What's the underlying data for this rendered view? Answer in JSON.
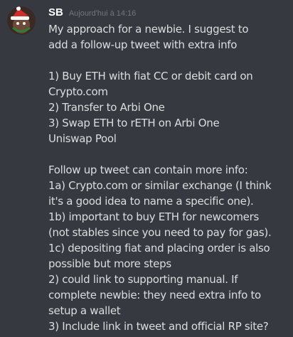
{
  "message": {
    "author": "SB",
    "timestamp": "Aujourd'hui à 14:16",
    "lines": [
      "My approach for a newbie. I suggest to",
      "add a follow-up tweet with extra info",
      "",
      "1) Buy ETH with fiat CC or debit card on",
      "Crypto.com",
      "2) Transfer to Arbi One",
      "3) Swap ETH to rETH on Arbi One",
      "Uniswap Pool",
      "",
      "Follow up tweet can contain more info:",
      "1a) Crypto.com or similar exchange (I think",
      "it's a good idea to name a specific one).",
      "1b) important to buy ETH for newcomers",
      "(not stables since you need to pay for gas).",
      "1c) depositing fiat and placing order is also",
      "possible but more steps",
      "2) could link to supporting manual. If",
      "complete newbie: they need extra info to",
      "setup a wallet",
      "3) Include link in tweet and official RP site?"
    ]
  },
  "colors": {
    "background": "#36393f",
    "username": "#ffffff",
    "timestamp": "#72767d",
    "text": "#dcddde"
  },
  "icons": {
    "avatar": "santa-hat-avatar-icon"
  }
}
